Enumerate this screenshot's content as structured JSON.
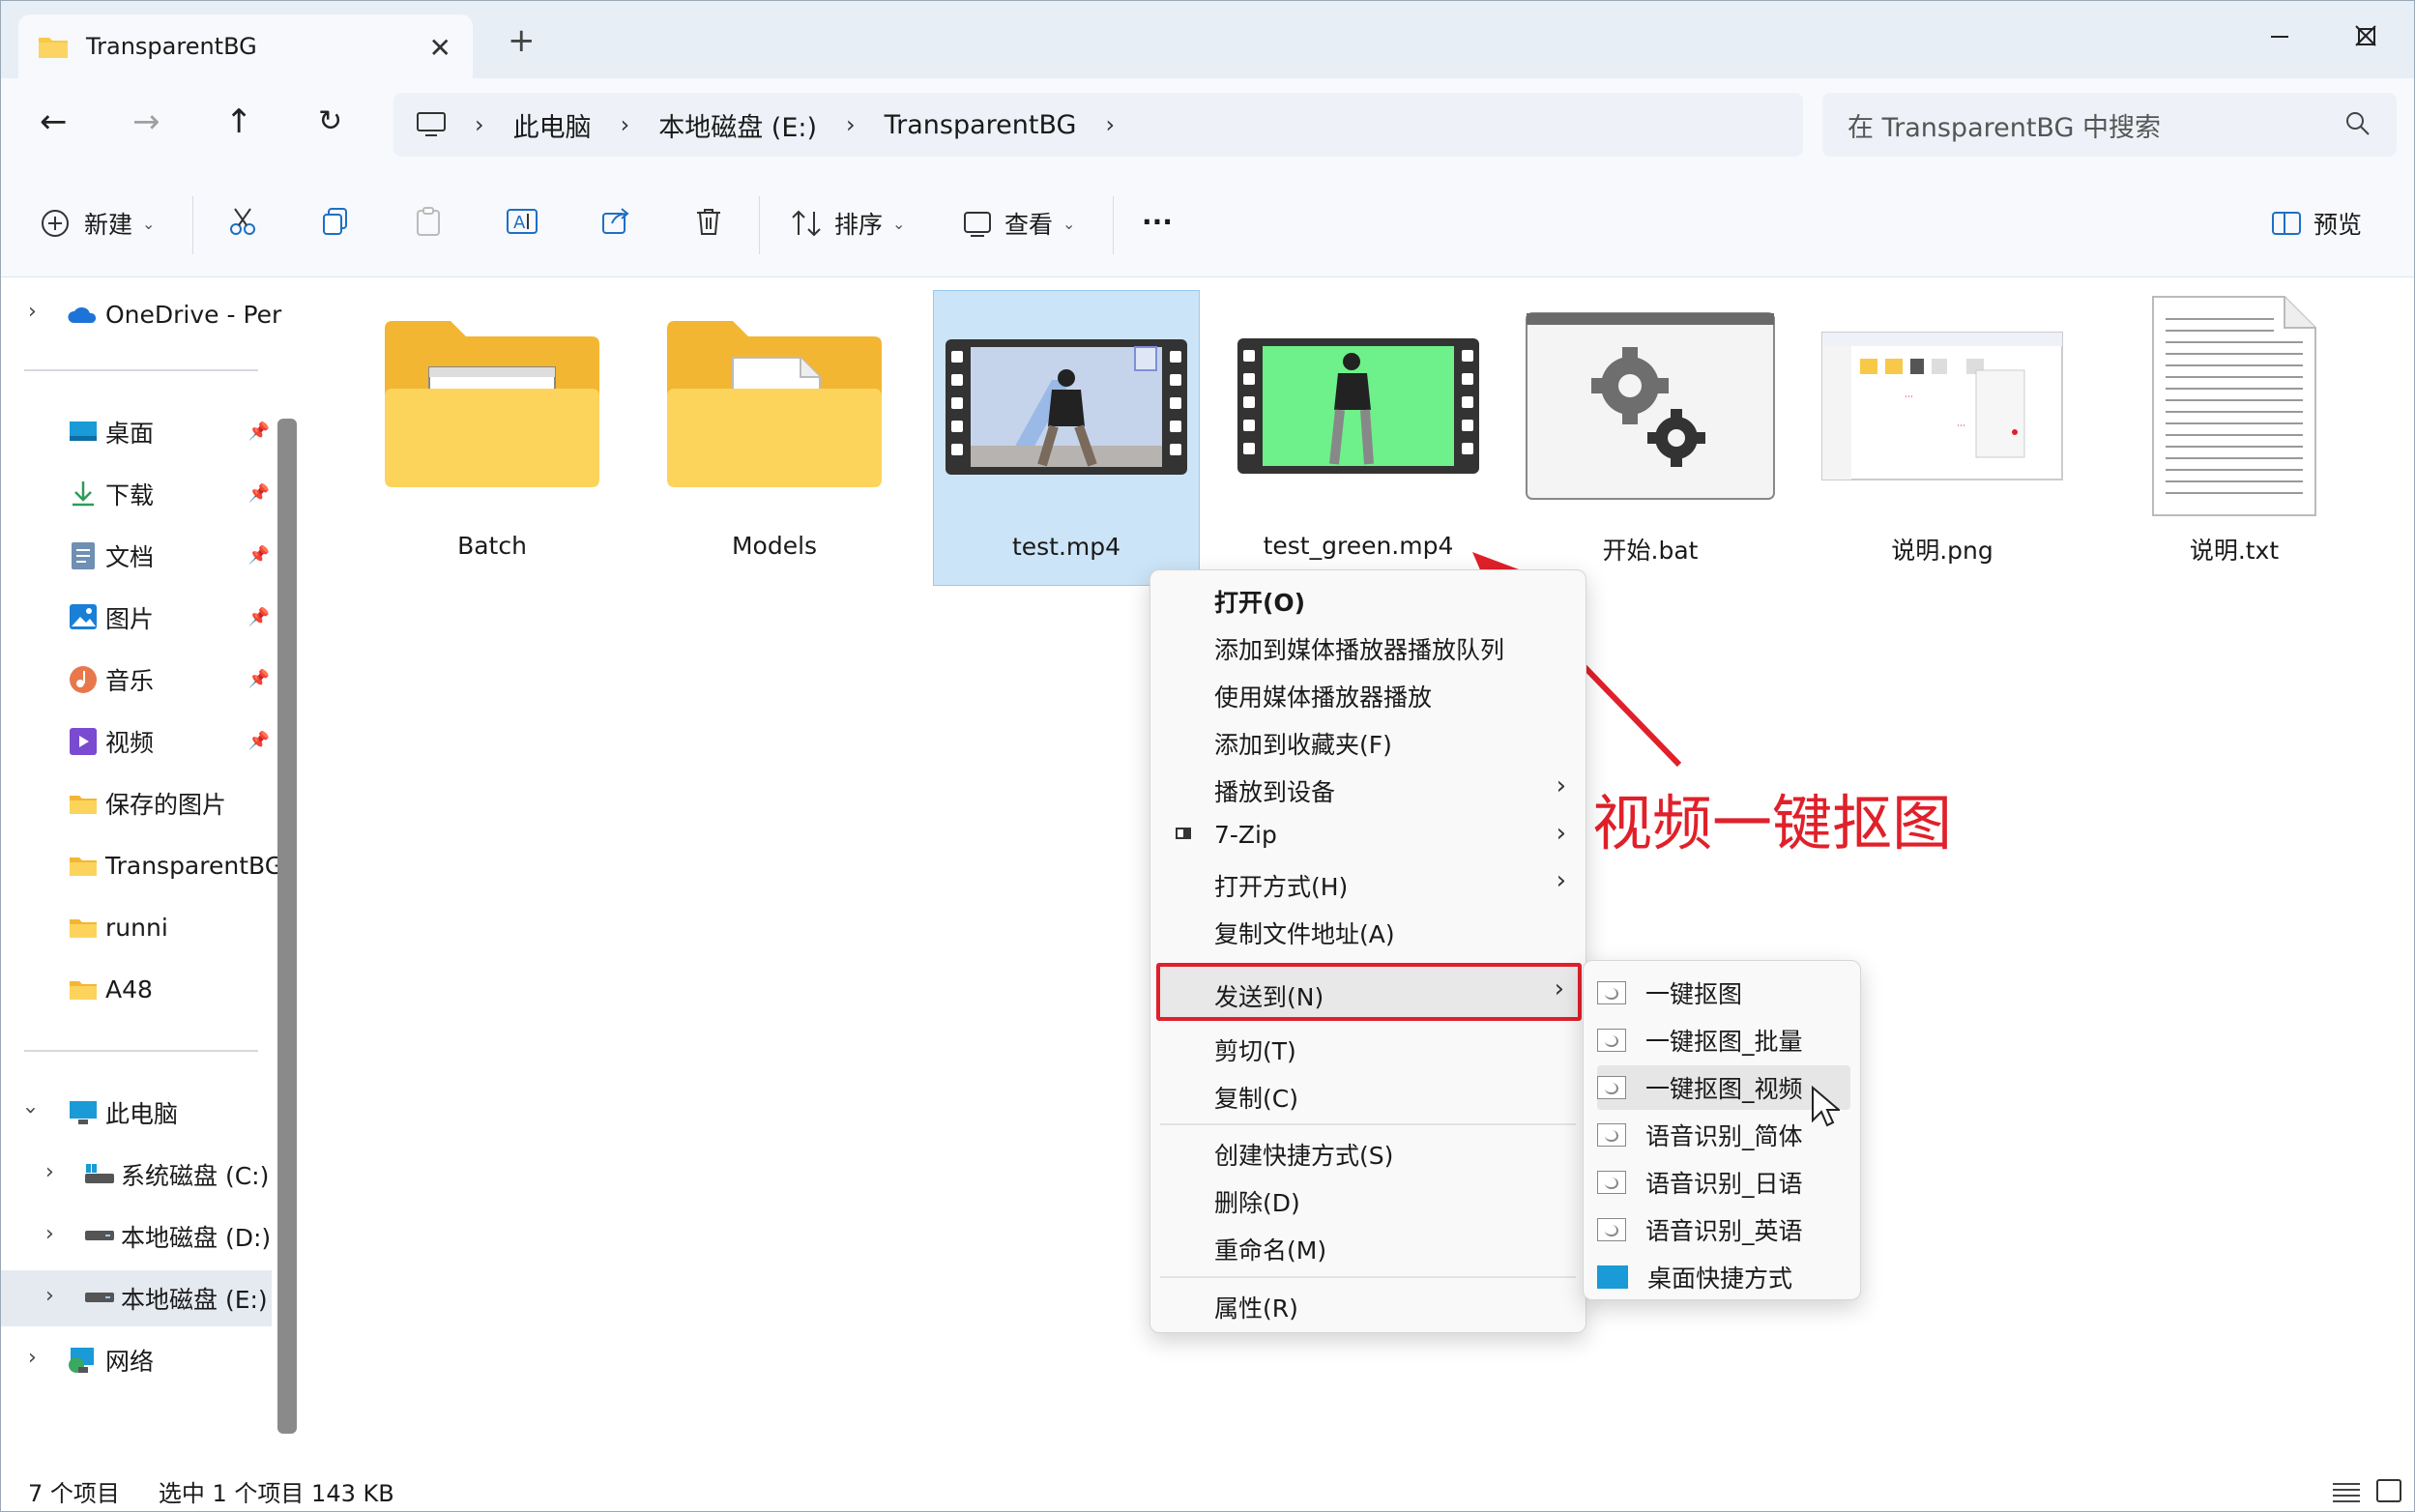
{
  "window": {
    "tab_title": "TransparentBG",
    "new_tab": "+"
  },
  "address": {
    "crumbs": [
      "此电脑",
      "本地磁盘 (E:)",
      "TransparentBG"
    ],
    "search_placeholder": "在 TransparentBG 中搜索"
  },
  "toolbar": {
    "new_label": "新建",
    "sort_label": "排序",
    "view_label": "查看",
    "more_label": "···",
    "preview_label": "预览"
  },
  "sidebar": {
    "onedrive": "OneDrive - Per",
    "quick": [
      {
        "label": "桌面",
        "icon": "desktop-icon",
        "pinned": true
      },
      {
        "label": "下载",
        "icon": "download-icon",
        "pinned": true
      },
      {
        "label": "文档",
        "icon": "documents-icon",
        "pinned": true
      },
      {
        "label": "图片",
        "icon": "pictures-icon",
        "pinned": true
      },
      {
        "label": "音乐",
        "icon": "music-icon",
        "pinned": true
      },
      {
        "label": "视频",
        "icon": "videos-icon",
        "pinned": true
      },
      {
        "label": "保存的图片",
        "icon": "folder-icon",
        "pinned": false
      },
      {
        "label": "TransparentBG",
        "icon": "folder-icon",
        "pinned": false
      },
      {
        "label": "runni",
        "icon": "folder-icon",
        "pinned": false
      },
      {
        "label": "A48",
        "icon": "folder-icon",
        "pinned": false
      }
    ],
    "this_pc": "此电脑",
    "drives": [
      "系统磁盘 (C:)",
      "本地磁盘 (D:)",
      "本地磁盘 (E:)"
    ],
    "network": "网络"
  },
  "files": [
    {
      "name": "Batch",
      "kind": "folder"
    },
    {
      "name": "Models",
      "kind": "folder"
    },
    {
      "name": "test.mp4",
      "kind": "video",
      "selected": true
    },
    {
      "name": "test_green.mp4",
      "kind": "video"
    },
    {
      "name": "开始.bat",
      "kind": "bat"
    },
    {
      "name": "说明.png",
      "kind": "image"
    },
    {
      "name": "说明.txt",
      "kind": "text"
    }
  ],
  "context_menu": {
    "items": [
      {
        "label": "打开(O)",
        "bold": true
      },
      {
        "label": "添加到媒体播放器播放队列"
      },
      {
        "label": "使用媒体播放器播放"
      },
      {
        "label": "添加到收藏夹(F)"
      },
      {
        "label": "播放到设备",
        "submenu": true
      },
      {
        "label": "7-Zip",
        "submenu": true
      },
      {
        "label": "打开方式(H)",
        "submenu": true
      },
      {
        "label": "复制文件地址(A)"
      },
      {
        "label": "发送到(N)",
        "submenu": true
      },
      {
        "label": "剪切(T)"
      },
      {
        "label": "复制(C)"
      },
      {
        "label": "创建快捷方式(S)"
      },
      {
        "label": "删除(D)"
      },
      {
        "label": "重命名(M)"
      },
      {
        "label": "属性(R)"
      }
    ]
  },
  "send_to_menu": {
    "items": [
      "一键抠图",
      "一键抠图_批量",
      "一键抠图_视频",
      "语音识别_简体",
      "语音识别_日语",
      "语音识别_英语",
      "桌面快捷方式"
    ]
  },
  "annotation": "视频一键抠图",
  "status": {
    "count": "7 个项目",
    "selection": "选中 1 个项目  143 KB"
  },
  "colors": {
    "accent": "#0067c0",
    "annotation": "#e0202a",
    "selection": "#cce4f7",
    "folder": "#f8c948"
  }
}
